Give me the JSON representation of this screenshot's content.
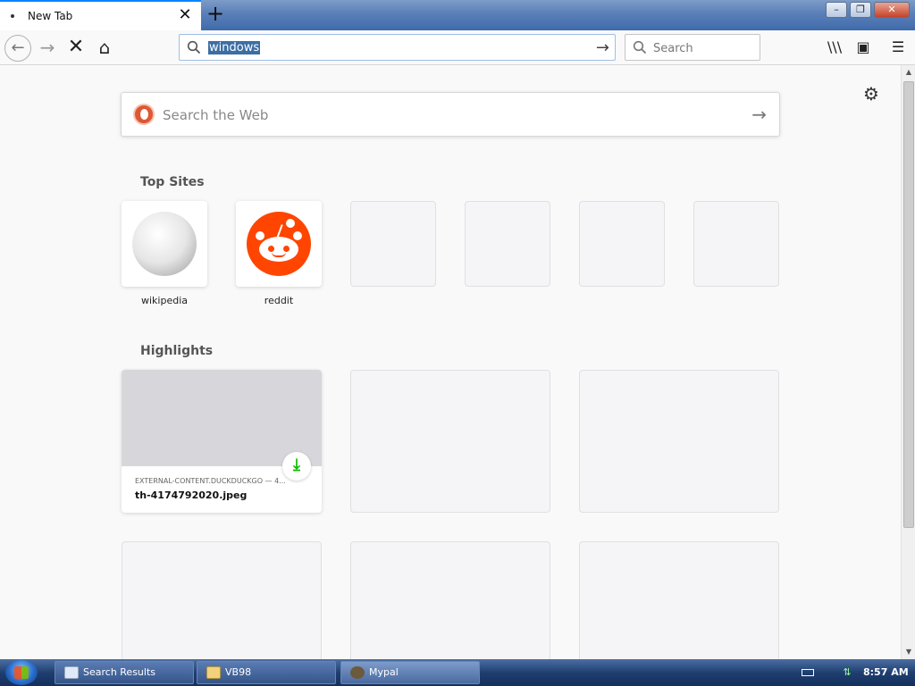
{
  "tabs": [
    {
      "title": "New Tab",
      "close": "✕"
    }
  ],
  "newtab_label": "+",
  "window_buttons": {
    "minimize": "–",
    "restore": "❐",
    "close": "✕"
  },
  "nav": {
    "back": "←",
    "forward": "→",
    "stop": "✕",
    "home": "⌂"
  },
  "urlbar": {
    "value": "windows",
    "go": "→"
  },
  "searchbar": {
    "placeholder": "Search"
  },
  "toolbar": {
    "library": "\\\\\\",
    "sidebar": "▣",
    "menu": "☰"
  },
  "content": {
    "settings": "⚙",
    "web_search": {
      "placeholder": "Search the Web",
      "go": "→"
    },
    "top_sites": {
      "title": "Top Sites",
      "items": [
        {
          "label": "wikipedia",
          "icon": "wikipedia-logo"
        },
        {
          "label": "reddit",
          "icon": "reddit-logo"
        },
        {
          "label": ""
        },
        {
          "label": ""
        },
        {
          "label": ""
        },
        {
          "label": ""
        }
      ]
    },
    "highlights": {
      "title": "Highlights",
      "items": [
        {
          "source": "EXTERNAL-CONTENT.DUCKDUCKGO — 4...",
          "name": "th-4174792020.jpeg",
          "icon": "download-icon",
          "icon_glyph": "⤓"
        }
      ]
    }
  },
  "scrollbar": {
    "up": "▲",
    "down": "▼"
  },
  "taskbar": {
    "items": [
      {
        "label": "Search Results",
        "icon": "document-icon"
      },
      {
        "label": "VB98",
        "icon": "folder-icon"
      },
      {
        "label": "Mypal",
        "icon": "mypal-icon"
      }
    ],
    "clock": "8:57 AM"
  },
  "colors": {
    "accent": "#0a84ff",
    "reddit": "#ff4500",
    "download": "#12bc00",
    "taskbar": "#1f3f70"
  }
}
